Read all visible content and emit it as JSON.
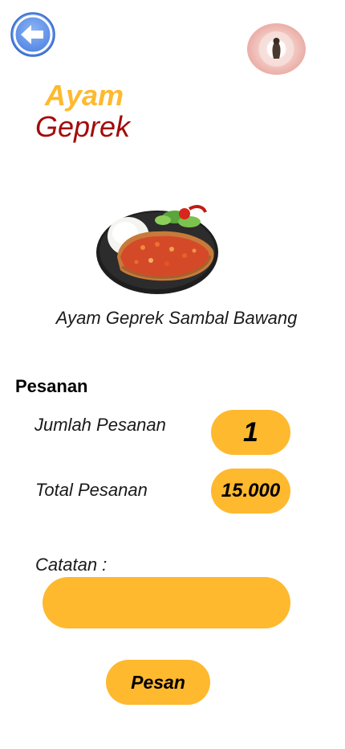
{
  "colors": {
    "accent": "#FEB92E",
    "title_primary": "#FEB92E",
    "title_secondary": "#A30B0B",
    "back_button": "#5B8EEA"
  },
  "header": {
    "back_icon": "arrow-left-icon",
    "avatar_icon": "profile-avatar"
  },
  "title": {
    "line1": "Ayam",
    "line2": "Geprek"
  },
  "product": {
    "image_icon": "fried-chicken-with-rice-image",
    "name": "Ayam Geprek Sambal Bawang"
  },
  "order": {
    "section_title": "Pesanan",
    "quantity_label": "Jumlah Pesanan",
    "quantity_value": "1",
    "total_label": "Total Pesanan",
    "total_value": "15.000",
    "note_label": "Catatan :",
    "note_value": "",
    "note_placeholder": ""
  },
  "actions": {
    "submit_label": "Pesan"
  }
}
